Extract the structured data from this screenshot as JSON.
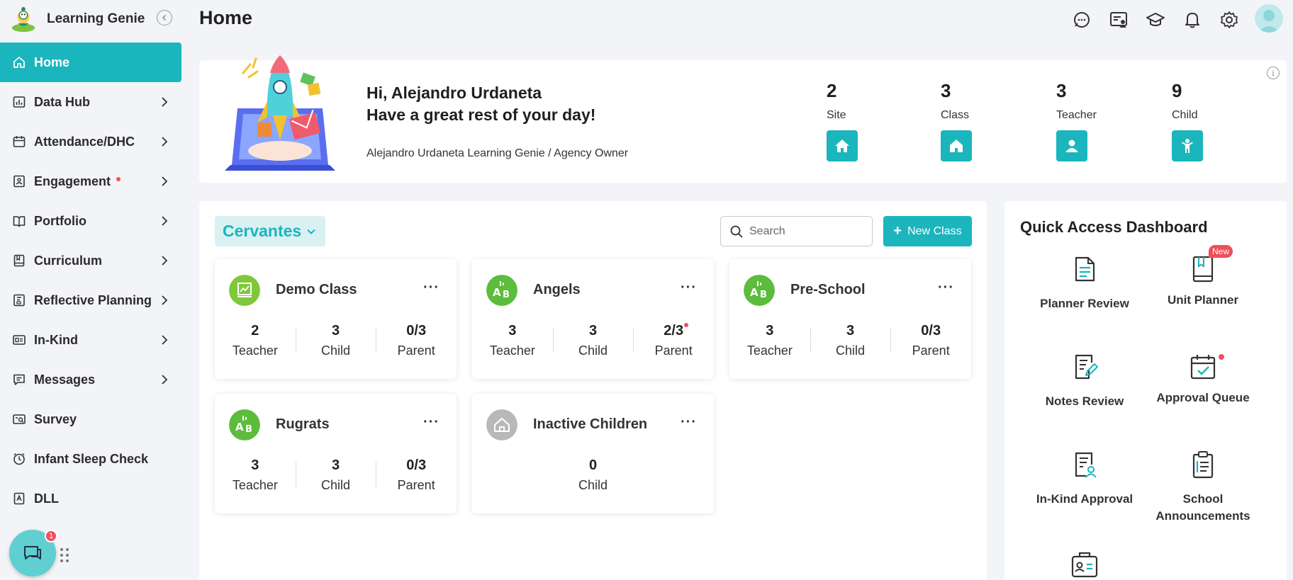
{
  "brand": {
    "name": "Learning Genie"
  },
  "sidebar": {
    "items": [
      {
        "label": "Home",
        "icon": "home-icon",
        "active": true
      },
      {
        "label": "Data Hub",
        "icon": "bar-chart-icon"
      },
      {
        "label": "Attendance/DHC",
        "icon": "calendar-icon"
      },
      {
        "label": "Engagement",
        "icon": "engagement-icon",
        "dot": true
      },
      {
        "label": "Portfolio",
        "icon": "portfolio-icon"
      },
      {
        "label": "Curriculum",
        "icon": "book-icon"
      },
      {
        "label": "Reflective Planning",
        "icon": "planning-icon"
      },
      {
        "label": "In-Kind",
        "icon": "in-kind-icon"
      },
      {
        "label": "Messages",
        "icon": "message-icon"
      },
      {
        "label": "Survey",
        "icon": "survey-icon"
      },
      {
        "label": "Infant Sleep Check",
        "icon": "clock-icon"
      },
      {
        "label": "DLL",
        "icon": "dll-icon"
      }
    ]
  },
  "chat": {
    "badge": "1"
  },
  "header": {
    "title": "Home"
  },
  "welcome": {
    "greeting": "Hi, Alejandro Urdaneta",
    "message": "Have a great rest of your day!",
    "role": "Alejandro Urdaneta Learning Genie / Agency Owner",
    "stats": [
      {
        "value": "2",
        "label": "Site"
      },
      {
        "value": "3",
        "label": "Class"
      },
      {
        "value": "3",
        "label": "Teacher"
      },
      {
        "value": "9",
        "label": "Child"
      }
    ]
  },
  "classes": {
    "site": "Cervantes",
    "search_placeholder": "Search",
    "new_class_label": "New Class",
    "cards": [
      {
        "name": "Demo Class",
        "teacher": "2",
        "child": "3",
        "parent": "0/3"
      },
      {
        "name": "Angels",
        "teacher": "3",
        "child": "3",
        "parent": "2/3"
      },
      {
        "name": "Pre-School",
        "teacher": "3",
        "child": "3",
        "parent": "0/3"
      },
      {
        "name": "Rugrats",
        "teacher": "3",
        "child": "3",
        "parent": "0/3"
      },
      {
        "name": "Inactive Children",
        "child": "0"
      }
    ],
    "labels": {
      "teacher": "Teacher",
      "child": "Child",
      "parent": "Parent"
    }
  },
  "quick_access": {
    "title": "Quick Access Dashboard",
    "items": [
      {
        "label": "Planner Review"
      },
      {
        "label": "Unit Planner",
        "badge": "New"
      },
      {
        "label": "Notes Review"
      },
      {
        "label": "Approval Queue"
      },
      {
        "label": "In-Kind Approval"
      },
      {
        "label": "School Announcements"
      }
    ]
  },
  "colors": {
    "accent": "#1bb5bd",
    "alert": "#f04e5a",
    "background": "#f3f4f7"
  }
}
